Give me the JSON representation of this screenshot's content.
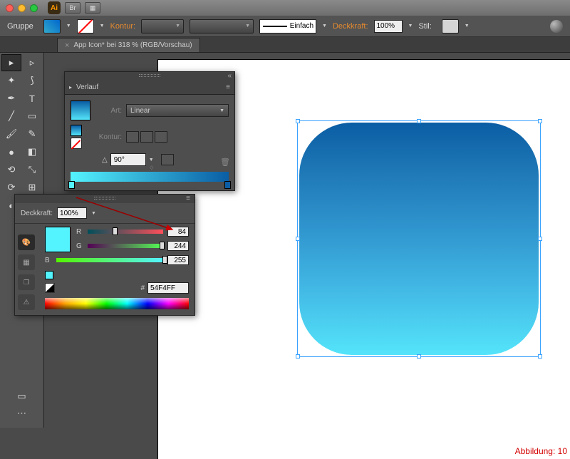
{
  "app": {
    "abbrev": "Ai",
    "br_btn": "Br"
  },
  "controlbar": {
    "group_label": "Gruppe",
    "kontur_label": "Kontur:",
    "stroke_style": "Einfach",
    "opacity_label": "Deckkraft:",
    "opacity_value": "100%",
    "style_label": "Stil:"
  },
  "doc": {
    "tab_title": "App Icon* bei 318 % (RGB/Vorschau)"
  },
  "gradient_panel": {
    "title": "Verlauf",
    "type_label": "Art:",
    "type_value": "Linear",
    "kontur_label": "Kontur:",
    "angle_value": "90°"
  },
  "color_panel": {
    "opacity_label": "Deckkraft:",
    "opacity_value": "100%",
    "r_label": "R",
    "r_value": "84",
    "g_label": "G",
    "g_value": "244",
    "b_label": "B",
    "b_value": "255",
    "hash": "#",
    "hex": "54F4FF"
  },
  "caption": "Abbildung: 10",
  "slider_pos": {
    "r": "33%",
    "g": "95%",
    "b": "99%"
  }
}
